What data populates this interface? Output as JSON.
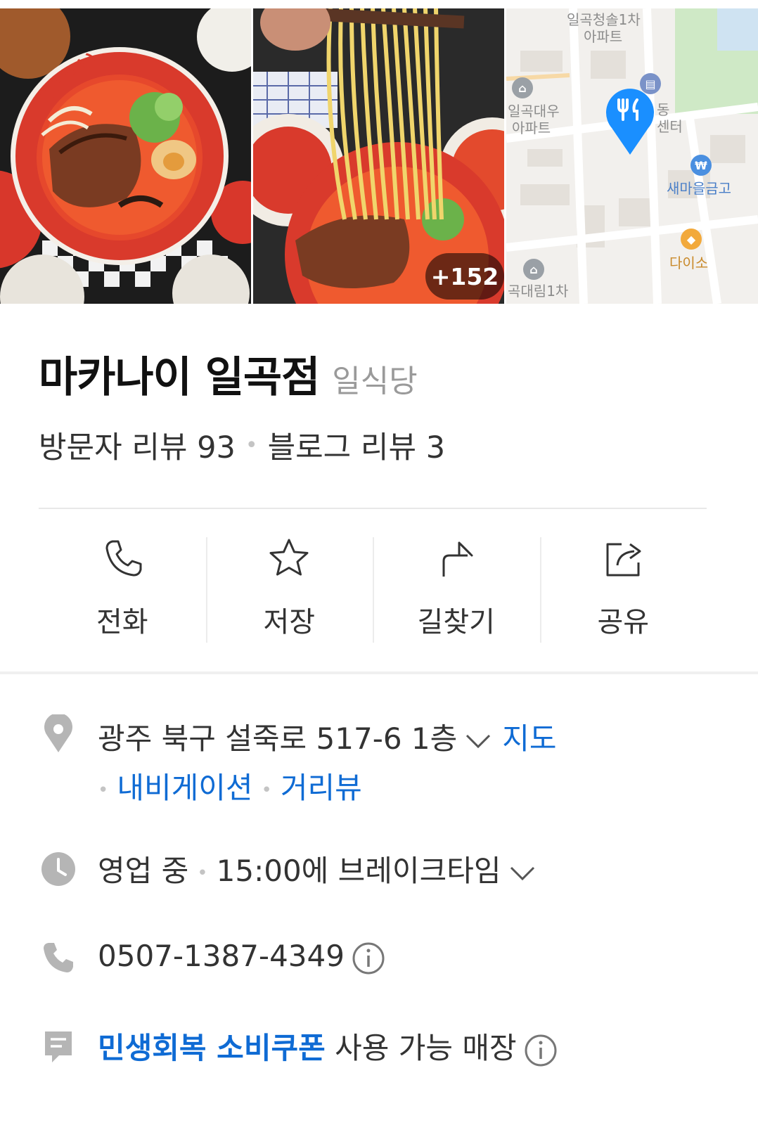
{
  "photos": {
    "more_count": "+152"
  },
  "map_thumb": {
    "labels": [
      "일곡청솔1차",
      "아파트",
      "일곡대우",
      "아파트",
      "동",
      "센터",
      "새마을금고",
      "다이소",
      "곡대림1차"
    ]
  },
  "place": {
    "name": "마카나이 일곡점",
    "category": "일식당"
  },
  "reviews": {
    "visitor": "방문자 리뷰 93",
    "blog": "블로그 리뷰 3"
  },
  "actions": [
    {
      "label": "전화",
      "icon": "phone-icon"
    },
    {
      "label": "저장",
      "icon": "star-icon"
    },
    {
      "label": "길찾기",
      "icon": "directions-icon"
    },
    {
      "label": "공유",
      "icon": "share-icon"
    }
  ],
  "address": {
    "text": "광주 북구 설죽로 517-6 1층",
    "map_link": "지도",
    "navigation_link": "내비게이션",
    "streetview_link": "거리뷰"
  },
  "hours": {
    "status": "영업 중",
    "detail": "15:00에 브레이크타임"
  },
  "phone": {
    "number": "0507-1387-4349"
  },
  "coupon": {
    "name": "민생회복 소비쿠폰",
    "suffix": "사용 가능 매장"
  },
  "colors": {
    "link": "#0f6bd4",
    "pin": "#1a8fff",
    "icon_gray": "#b5b5b5"
  }
}
